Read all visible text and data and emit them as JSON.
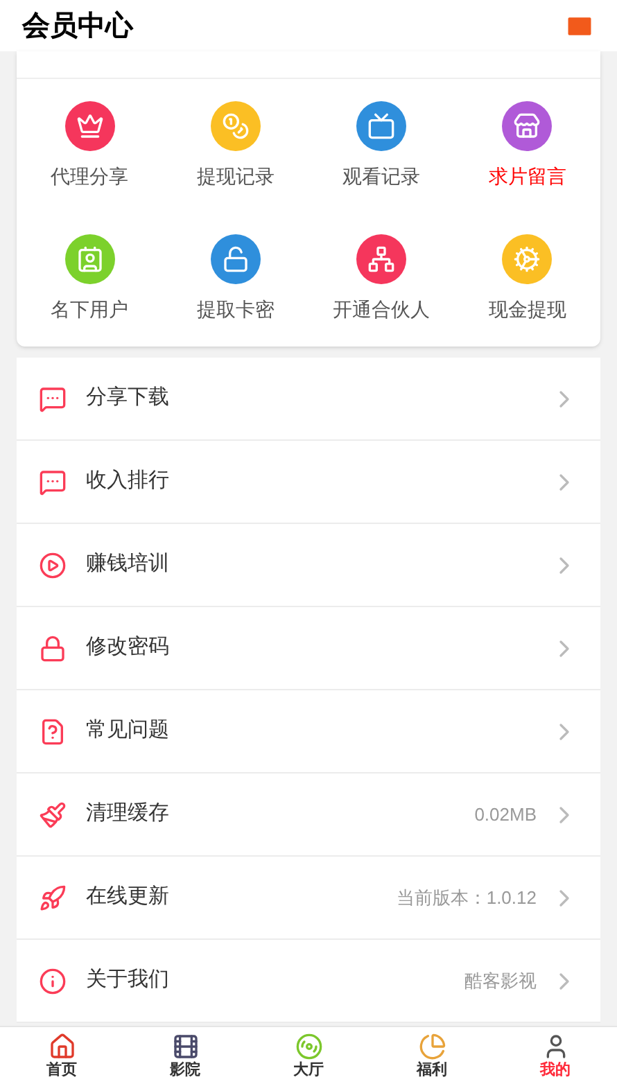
{
  "header": {
    "title": "会员中心"
  },
  "tools": [
    {
      "label": "代理分享",
      "color": "#f5365c",
      "highlighted": false
    },
    {
      "label": "提现记录",
      "color": "#fbbf24",
      "highlighted": false
    },
    {
      "label": "观看记录",
      "color": "#2f8fdc",
      "highlighted": false
    },
    {
      "label": "求片留言",
      "color": "#b05ad8",
      "highlighted": true
    },
    {
      "label": "名下用户",
      "color": "#7cd12c",
      "highlighted": false
    },
    {
      "label": "提取卡密",
      "color": "#2f8fdc",
      "highlighted": false
    },
    {
      "label": "开通合伙人",
      "color": "#f5365c",
      "highlighted": false
    },
    {
      "label": "现金提现",
      "color": "#fbbf24",
      "highlighted": false
    }
  ],
  "menu": [
    {
      "label": "分享下载"
    },
    {
      "label": "收入排行"
    },
    {
      "label": "赚钱培训"
    },
    {
      "label": "修改密码"
    },
    {
      "label": "常见问题"
    },
    {
      "label": "清理缓存",
      "value": "0.02MB"
    },
    {
      "label": "在线更新",
      "value": "当前版本：1.0.12"
    },
    {
      "label": "关于我们",
      "value": "酷客影视"
    }
  ],
  "tabs": [
    {
      "label": "首页",
      "selected": false
    },
    {
      "label": "影院",
      "selected": false
    },
    {
      "label": "大厅",
      "selected": false
    },
    {
      "label": "福利",
      "selected": false
    },
    {
      "label": "我的",
      "selected": true
    }
  ]
}
